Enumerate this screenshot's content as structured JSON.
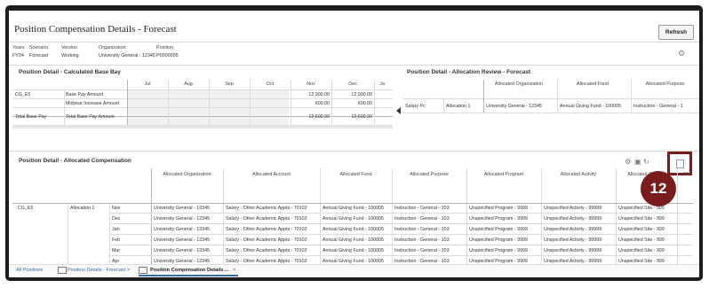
{
  "title": "Position Compensation Details - Forecast",
  "refresh_label": "Refresh",
  "pov": {
    "headers": [
      "Years",
      "Scenario",
      "Version",
      "Organization",
      "Position"
    ],
    "values": [
      "FY24",
      "Forecast",
      "Working",
      "University General : 12345",
      "P0000005"
    ]
  },
  "calc": {
    "title": "Position Detail - Calculated Base Bay",
    "months": [
      "Jul",
      "Aug",
      "Sep",
      "Oct",
      "Nov",
      "Dec",
      "Ja"
    ],
    "rows": [
      {
        "col1": "CG_E5",
        "col2": "Base Pay Amount",
        "nov": "12,000.00",
        "dec": "12,000.00"
      },
      {
        "col1": "",
        "col2": "Midyear Increase Amount",
        "nov": "600.00",
        "dec": "600.00"
      },
      {
        "col1": "Total Base Pay",
        "col2": "Total Base Pay Amount",
        "nov": "12,600.00",
        "dec": "12,600.00"
      }
    ]
  },
  "review": {
    "title": "Position Detail - Allocation Review - Forecast",
    "headers": [
      "Allocated Organization",
      "Allocated Fund",
      "Allocated Purpose"
    ],
    "row": [
      "Salary Pc",
      "Allocation 1",
      "University General - 12345",
      "Annual Giving Fund - 100005",
      "Instruction - General - 1"
    ]
  },
  "alloc": {
    "title": "Position Detail - Allocated Compensation",
    "headers": [
      "Allocated Organization",
      "Allocated Account",
      "Allocated Fund",
      "Allocated Purpose",
      "Allocated Program",
      "Allocated Activity",
      "Allocated S",
      "Allo"
    ],
    "row_label": "CG_E5",
    "alloc_label": "Allocation 1",
    "rows": [
      {
        "month": "Nov",
        "cells": [
          "University General - 12345",
          "Salary - Other Academic Appts - 70102",
          "Annual Giving Fund - 100005",
          "Instruction - General - 103",
          "Unspecified Program - 9999",
          "Unspecified Activity - 99999",
          "Unspecified Site - 999"
        ]
      },
      {
        "month": "Dec",
        "cells": [
          "University General - 12345",
          "Salary - Other Academic Appts - 70102",
          "Annual Giving Fund - 100005",
          "Instruction - General - 103",
          "Unspecified Program - 9999",
          "Unspecified Activity - 99999",
          "Unspecified Site - 999"
        ]
      },
      {
        "month": "Jan",
        "cells": [
          "University General - 12345",
          "Salary - Other Academic Appts - 70102",
          "Annual Giving Fund - 100005",
          "Instruction - General - 103",
          "Unspecified Program - 9999",
          "Unspecified Activity - 99999",
          "Unspecified Site - 999"
        ]
      },
      {
        "month": "Feb",
        "cells": [
          "University General - 12345",
          "Salary - Other Academic Appts - 70102",
          "Annual Giving Fund - 100005",
          "Instruction - General - 103",
          "Unspecified Program - 9999",
          "Unspecified Activity - 99999",
          "Unspecified Site - 999"
        ]
      },
      {
        "month": "Mar",
        "cells": [
          "University General - 12345",
          "Salary - Other Academic Appts - 70102",
          "Annual Giving Fund - 100005",
          "Instruction - General - 103",
          "Unspecified Program - 9999",
          "Unspecified Activity - 99999",
          "Unspecified Site - 999"
        ]
      },
      {
        "month": "Apr",
        "cells": [
          "University General - 12345",
          "Salary - Other Academic Appts - 70102",
          "Annual Giving Fund - 100005",
          "Instruction - General - 103",
          "Unspecified Program - 9999",
          "Unspecified Activity - 99999",
          "Unspecified Site - 999"
        ]
      }
    ]
  },
  "callout": "12",
  "tabs": [
    "All Positions",
    "Position Details - Forecast",
    "Position Compensation Details ..."
  ],
  "accent": "#7a1c1c",
  "icons": [
    "settings-icon",
    "save-icon",
    "refresh-icon",
    "export-icon",
    "tab-form-icon"
  ]
}
